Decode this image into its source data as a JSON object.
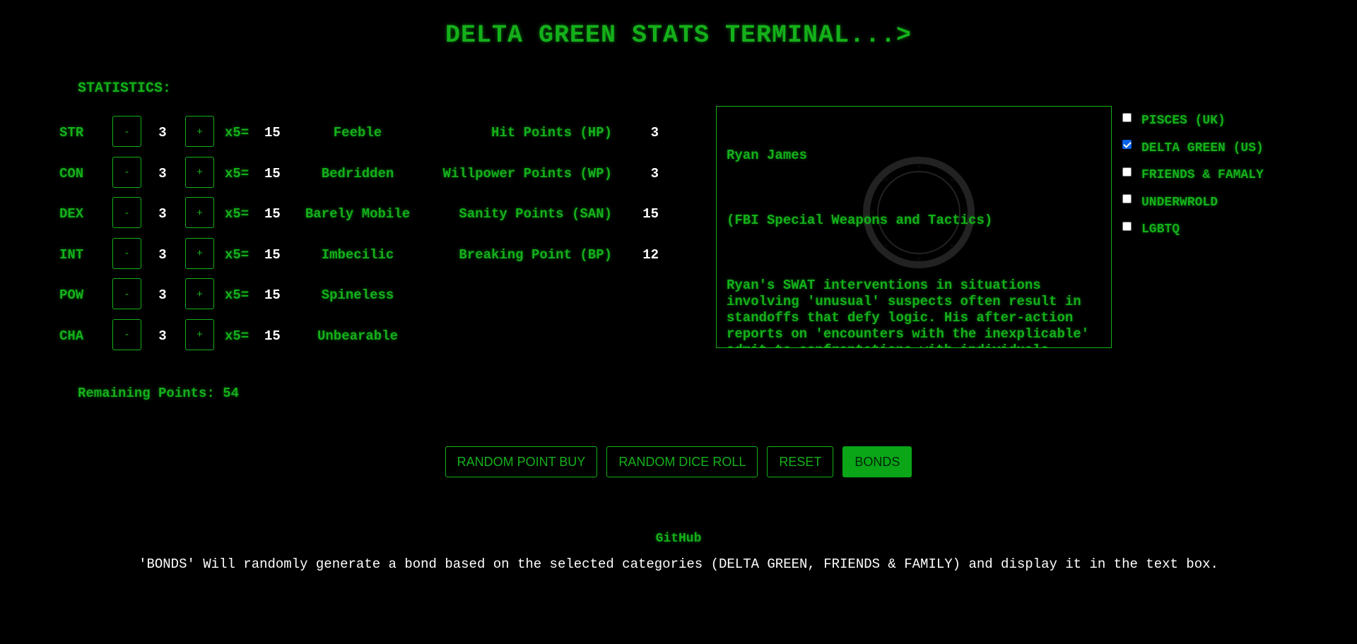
{
  "title": "DELTA GREEN STATS TERMINAL...>",
  "statistics_label": "STATISTICS:",
  "controls": {
    "minus_label": "-",
    "plus_label": "+",
    "multiplier_label": "x5="
  },
  "stats": [
    {
      "name": "STR",
      "value": "3",
      "score": "15",
      "descriptor": "Feeble",
      "derived_label": "Hit Points (HP)",
      "derived_value": "3"
    },
    {
      "name": "CON",
      "value": "3",
      "score": "15",
      "descriptor": "Bedridden",
      "derived_label": "Willpower Points (WP)",
      "derived_value": "3"
    },
    {
      "name": "DEX",
      "value": "3",
      "score": "15",
      "descriptor": "Barely Mobile",
      "derived_label": "Sanity Points (SAN)",
      "derived_value": "15"
    },
    {
      "name": "INT",
      "value": "3",
      "score": "15",
      "descriptor": "Imbecilic",
      "derived_label": "Breaking Point (BP)",
      "derived_value": "12"
    },
    {
      "name": "POW",
      "value": "3",
      "score": "15",
      "descriptor": "Spineless"
    },
    {
      "name": "CHA",
      "value": "3",
      "score": "15",
      "descriptor": "Unbearable"
    }
  ],
  "remaining_points": "Remaining Points: 54",
  "bond": {
    "name": "Ryan James",
    "role": "(FBI Special Weapons and Tactics)",
    "description": "Ryan's SWAT interventions in situations involving 'unusual' suspects often result in standoffs that defy logic. His after-action reports on 'encounters with the inexplicable' admit to confrontations with individuals displaying abilities beyond human."
  },
  "categories": [
    {
      "label": "PISCES (UK)",
      "checked": false
    },
    {
      "label": "DELTA GREEN (US)",
      "checked": true
    },
    {
      "label": "FRIENDS & FAMALY",
      "checked": false
    },
    {
      "label": "UNDERWROLD",
      "checked": false
    },
    {
      "label": "LGBTQ",
      "checked": false
    }
  ],
  "actions": {
    "random_point_buy": "RANDOM POINT BUY",
    "random_dice_roll": "RANDOM DICE ROLL",
    "reset": "RESET",
    "bonds": "BONDS"
  },
  "github_link": "GitHub",
  "footer_note": "'BONDS' Will randomly generate a bond based on the selected categories (DELTA GREEN, FRIENDS & FAMILY) and display it in the text box.",
  "colors": {
    "background": "#000000",
    "terminal_green": "#14b01a",
    "active_button": "#0aa617",
    "value_text": "#ffffff",
    "checkbox_checked": "#0a63e8"
  }
}
